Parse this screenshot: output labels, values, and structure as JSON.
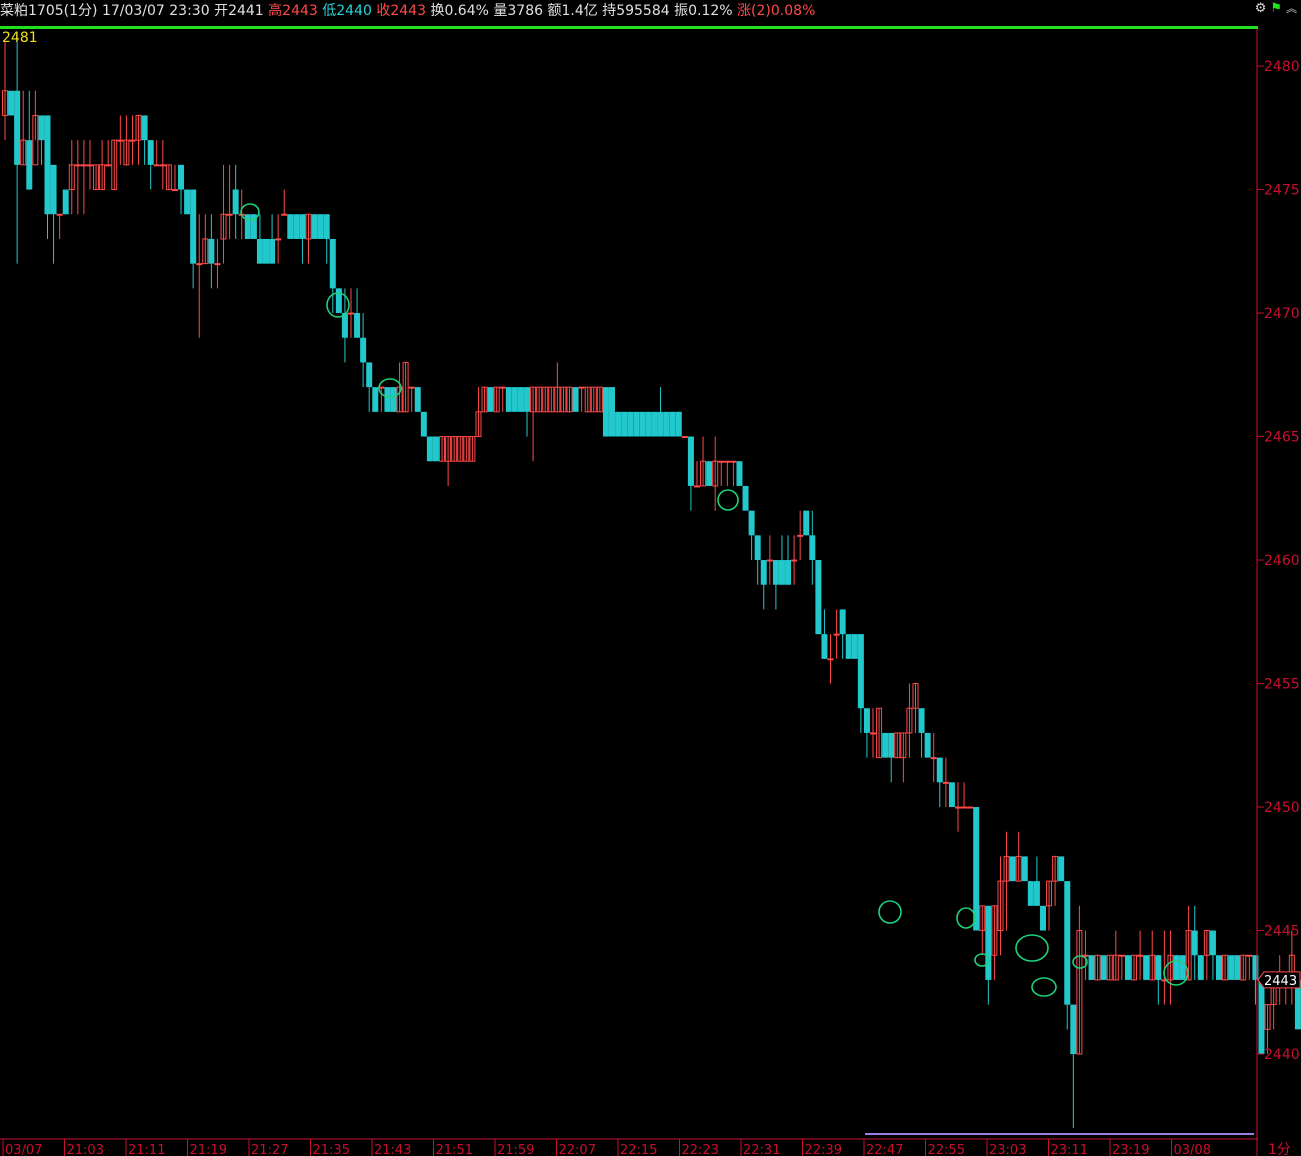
{
  "header": {
    "symbol": "菜粕1705",
    "period": "(1分)",
    "datetime": "17/03/07 23:30",
    "open_label": "开",
    "open": "2441",
    "high_label": "高",
    "high": "2443",
    "low_label": "低",
    "low": "2440",
    "close_label": "收",
    "close": "2443",
    "turnover_label": "换",
    "turnover": "0.64%",
    "volume_label": "量",
    "volume": "3786",
    "amount_label": "额",
    "amount": "1.4亿",
    "oi_label": "持",
    "oi": "595584",
    "amp_label": "振",
    "amp": "0.12%",
    "chg_label": "涨(2)",
    "chg": "0.08%",
    "icons": [
      "gear-icon",
      "flag-icon",
      "chevron-up-icon"
    ]
  },
  "top_price_label": "2481",
  "current_price_tag": "2443",
  "period_button": "1分",
  "colors": {
    "up": "#ff4a4a",
    "down": "#22c8cc",
    "accent": "#22e01e",
    "annot": "#1fd07a"
  },
  "chart_data": {
    "type": "candlestick",
    "symbol": "菜粕1705",
    "y_ticks": [
      2480,
      2475,
      2470,
      2465,
      2460,
      2455,
      2450,
      2445,
      2440
    ],
    "ylim": [
      2436.6,
      2481.5
    ],
    "x_ticks": [
      "03/07",
      "21:03",
      "21:11",
      "21:19",
      "21:27",
      "21:35",
      "21:43",
      "21:51",
      "21:59",
      "22:07",
      "22:15",
      "22:23",
      "22:31",
      "22:39",
      "22:47",
      "22:55",
      "23:03",
      "23:11",
      "23:19",
      "03/08"
    ],
    "candles": [
      [
        2478,
        2479,
        2477,
        2481
      ],
      [
        2479,
        2478,
        2478,
        2479
      ],
      [
        2479,
        2476,
        2472,
        2481
      ],
      [
        2476,
        2477,
        2476,
        2479
      ],
      [
        2477,
        2475,
        2475,
        2479
      ],
      [
        2476,
        2478,
        2477,
        2479
      ],
      [
        2478,
        2477,
        2476,
        2478
      ],
      [
        2478,
        2474,
        2473,
        2478
      ],
      [
        2476,
        2474,
        2472,
        2476
      ],
      [
        2474,
        2474,
        2473,
        2474
      ],
      [
        2475,
        2474,
        2474,
        2475
      ],
      [
        2475,
        2476,
        2474,
        2477
      ],
      [
        2476,
        2476,
        2474,
        2477
      ],
      [
        2476,
        2476,
        2474,
        2477
      ],
      [
        2476,
        2476,
        2475,
        2477
      ],
      [
        2475,
        2476,
        2475,
        2476
      ],
      [
        2475,
        2476,
        2475,
        2477
      ],
      [
        2476,
        2476,
        2476,
        2477
      ],
      [
        2475,
        2477,
        2475,
        2477
      ],
      [
        2477,
        2477,
        2476,
        2478
      ],
      [
        2476,
        2477,
        2476,
        2478
      ],
      [
        2477,
        2477,
        2476,
        2478
      ],
      [
        2477,
        2478,
        2476,
        2478
      ],
      [
        2478,
        2477,
        2476,
        2478
      ],
      [
        2477,
        2476,
        2475,
        2477
      ],
      [
        2476,
        2476,
        2476,
        2477
      ],
      [
        2476,
        2476,
        2475,
        2477
      ],
      [
        2475,
        2476,
        2475,
        2476
      ],
      [
        2475,
        2475,
        2475,
        2476
      ],
      [
        2476,
        2475,
        2474,
        2476
      ],
      [
        2475,
        2474,
        2474,
        2475
      ],
      [
        2475,
        2472,
        2471,
        2475
      ],
      [
        2472,
        2472,
        2469,
        2474
      ],
      [
        2472,
        2473,
        2472,
        2474
      ],
      [
        2473,
        2472,
        2471,
        2474
      ],
      [
        2472,
        2472,
        2471,
        2473
      ],
      [
        2473,
        2474,
        2472,
        2476
      ],
      [
        2474,
        2474,
        2473,
        2476
      ],
      [
        2475,
        2474,
        2473,
        2476
      ],
      [
        2474,
        2474,
        2473,
        2475
      ],
      [
        2474,
        2473,
        2473,
        2474
      ],
      [
        2474,
        2473,
        2473,
        2474
      ],
      [
        2473,
        2472,
        2472,
        2474
      ],
      [
        2473,
        2472,
        2472,
        2473
      ],
      [
        2473,
        2472,
        2472,
        2474
      ],
      [
        2473,
        2473,
        2472,
        2474
      ],
      [
        2474,
        2474,
        2474,
        2475
      ],
      [
        2474,
        2473,
        2473,
        2474
      ],
      [
        2474,
        2473,
        2473,
        2474
      ],
      [
        2474,
        2473,
        2472,
        2474
      ],
      [
        2473,
        2474,
        2472,
        2474
      ],
      [
        2474,
        2473,
        2473,
        2474
      ],
      [
        2474,
        2473,
        2473,
        2474
      ],
      [
        2474,
        2473,
        2472,
        2474
      ],
      [
        2473,
        2471,
        2470,
        2473
      ],
      [
        2471,
        2470,
        2470,
        2471
      ],
      [
        2470,
        2469,
        2468,
        2471
      ],
      [
        2470,
        2470,
        2469,
        2471
      ],
      [
        2470,
        2469,
        2469,
        2471
      ],
      [
        2469,
        2468,
        2467,
        2470
      ],
      [
        2468,
        2467,
        2466,
        2468
      ],
      [
        2467,
        2466,
        2466,
        2467
      ],
      [
        2467,
        2467,
        2466,
        2467
      ],
      [
        2467,
        2466,
        2466,
        2467
      ],
      [
        2467,
        2466,
        2466,
        2467
      ],
      [
        2466,
        2467,
        2466,
        2468
      ],
      [
        2466,
        2468,
        2466,
        2468
      ],
      [
        2467,
        2467,
        2466,
        2467
      ],
      [
        2467,
        2466,
        2466,
        2467
      ],
      [
        2466,
        2465,
        2465,
        2466
      ],
      [
        2465,
        2464,
        2464,
        2465
      ],
      [
        2465,
        2464,
        2464,
        2465
      ],
      [
        2464,
        2465,
        2464,
        2465
      ],
      [
        2464,
        2465,
        2463,
        2465
      ],
      [
        2464,
        2465,
        2464,
        2465
      ],
      [
        2464,
        2465,
        2464,
        2465
      ],
      [
        2464,
        2465,
        2464,
        2465
      ],
      [
        2464,
        2465,
        2464,
        2465
      ],
      [
        2465,
        2466,
        2465,
        2467
      ],
      [
        2466,
        2467,
        2466,
        2467
      ],
      [
        2467,
        2466,
        2466,
        2467
      ],
      [
        2466,
        2467,
        2466,
        2467
      ],
      [
        2467,
        2467,
        2466,
        2467
      ],
      [
        2467,
        2466,
        2466,
        2467
      ],
      [
        2467,
        2466,
        2466,
        2467
      ],
      [
        2467,
        2466,
        2466,
        2467
      ],
      [
        2467,
        2466,
        2465,
        2467
      ],
      [
        2466,
        2467,
        2464,
        2467
      ],
      [
        2466,
        2467,
        2466,
        2467
      ],
      [
        2466,
        2467,
        2466,
        2467
      ],
      [
        2466,
        2467,
        2466,
        2467
      ],
      [
        2466,
        2467,
        2466,
        2468
      ],
      [
        2466,
        2467,
        2466,
        2467
      ],
      [
        2466,
        2467,
        2466,
        2467
      ],
      [
        2467,
        2466,
        2466,
        2467
      ],
      [
        2467,
        2467,
        2466,
        2467
      ],
      [
        2466,
        2467,
        2466,
        2467
      ],
      [
        2466,
        2467,
        2466,
        2467
      ],
      [
        2466,
        2467,
        2466,
        2467
      ],
      [
        2467,
        2465,
        2465,
        2467
      ],
      [
        2467,
        2465,
        2465,
        2467
      ],
      [
        2466,
        2465,
        2465,
        2466
      ],
      [
        2466,
        2465,
        2465,
        2466
      ],
      [
        2466,
        2465,
        2465,
        2466
      ],
      [
        2466,
        2465,
        2465,
        2466
      ],
      [
        2466,
        2465,
        2465,
        2466
      ],
      [
        2466,
        2465,
        2465,
        2466
      ],
      [
        2466,
        2465,
        2465,
        2466
      ],
      [
        2466,
        2465,
        2465,
        2467
      ],
      [
        2466,
        2465,
        2465,
        2466
      ],
      [
        2466,
        2465,
        2465,
        2466
      ],
      [
        2466,
        2465,
        2465,
        2466
      ],
      [
        2465,
        2465,
        2465,
        2465
      ],
      [
        2465,
        2463,
        2462,
        2465
      ],
      [
        2463,
        2463,
        2463,
        2464
      ],
      [
        2463,
        2464,
        2463,
        2465
      ],
      [
        2464,
        2463,
        2463,
        2464
      ],
      [
        2463,
        2464,
        2462,
        2465
      ],
      [
        2464,
        2464,
        2463,
        2464
      ],
      [
        2464,
        2464,
        2463,
        2464
      ],
      [
        2464,
        2464,
        2463,
        2464
      ],
      [
        2464,
        2463,
        2463,
        2464
      ],
      [
        2463,
        2462,
        2462,
        2463
      ],
      [
        2462,
        2461,
        2460,
        2462
      ],
      [
        2461,
        2460,
        2459,
        2461
      ],
      [
        2460,
        2459,
        2458,
        2460
      ],
      [
        2460,
        2460,
        2459,
        2461
      ],
      [
        2460,
        2459,
        2458,
        2460
      ],
      [
        2460,
        2459,
        2459,
        2461
      ],
      [
        2460,
        2459,
        2459,
        2461
      ],
      [
        2460,
        2460,
        2459,
        2461
      ],
      [
        2461,
        2461,
        2460,
        2462
      ],
      [
        2462,
        2461,
        2461,
        2462
      ],
      [
        2461,
        2460,
        2459,
        2462
      ],
      [
        2460,
        2457,
        2457,
        2460
      ],
      [
        2457,
        2456,
        2456,
        2458
      ],
      [
        2456,
        2456,
        2455,
        2457
      ],
      [
        2457,
        2457,
        2456,
        2458
      ],
      [
        2458,
        2457,
        2456,
        2458
      ],
      [
        2457,
        2456,
        2456,
        2457
      ],
      [
        2457,
        2456,
        2456,
        2457
      ],
      [
        2457,
        2454,
        2453,
        2457
      ],
      [
        2454,
        2453,
        2452,
        2454
      ],
      [
        2453,
        2453,
        2452,
        2454
      ],
      [
        2452,
        2454,
        2452,
        2454
      ],
      [
        2453,
        2452,
        2452,
        2453
      ],
      [
        2453,
        2452,
        2451,
        2453
      ],
      [
        2452,
        2453,
        2452,
        2453
      ],
      [
        2452,
        2453,
        2451,
        2453
      ],
      [
        2453,
        2454,
        2452,
        2455
      ],
      [
        2454,
        2455,
        2453,
        2455
      ],
      [
        2454,
        2453,
        2452,
        2454
      ],
      [
        2453,
        2452,
        2452,
        2453
      ],
      [
        2452,
        2452,
        2451,
        2453
      ],
      [
        2452,
        2451,
        2450,
        2452
      ],
      [
        2451,
        2451,
        2450,
        2452
      ],
      [
        2451,
        2450,
        2450,
        2451
      ],
      [
        2450,
        2450,
        2449,
        2451
      ],
      [
        2450,
        2450,
        2450,
        2451
      ],
      [
        2450,
        2450,
        2450,
        2450
      ],
      [
        2450,
        2445,
        2445,
        2450
      ],
      [
        2445,
        2446,
        2444,
        2446
      ],
      [
        2446,
        2443,
        2442,
        2446
      ],
      [
        2444,
        2446,
        2443,
        2446
      ],
      [
        2445,
        2447,
        2444,
        2448
      ],
      [
        2447,
        2448,
        2445,
        2449
      ],
      [
        2448,
        2447,
        2447,
        2448
      ],
      [
        2447,
        2448,
        2447,
        2449
      ],
      [
        2448,
        2447,
        2447,
        2448
      ],
      [
        2447,
        2446,
        2446,
        2447
      ],
      [
        2447,
        2446,
        2446,
        2448
      ],
      [
        2446,
        2445,
        2445,
        2446
      ],
      [
        2446,
        2447,
        2445,
        2447
      ],
      [
        2447,
        2448,
        2446,
        2448
      ],
      [
        2448,
        2447,
        2447,
        2448
      ],
      [
        2447,
        2442,
        2441,
        2447
      ],
      [
        2442,
        2440,
        2437,
        2442
      ],
      [
        2440,
        2445,
        2440,
        2446
      ],
      [
        2444,
        2444,
        2443,
        2445
      ],
      [
        2444,
        2443,
        2443,
        2444
      ],
      [
        2443,
        2444,
        2443,
        2444
      ],
      [
        2444,
        2443,
        2443,
        2444
      ],
      [
        2443,
        2444,
        2443,
        2444
      ],
      [
        2443,
        2444,
        2443,
        2445
      ],
      [
        2444,
        2444,
        2443,
        2444
      ],
      [
        2444,
        2443,
        2443,
        2444
      ],
      [
        2443,
        2444,
        2443,
        2444
      ],
      [
        2444,
        2444,
        2443,
        2445
      ],
      [
        2444,
        2443,
        2443,
        2444
      ],
      [
        2443,
        2444,
        2443,
        2445
      ],
      [
        2444,
        2443,
        2442,
        2444
      ],
      [
        2443,
        2443,
        2442,
        2445
      ],
      [
        2443,
        2444,
        2442,
        2445
      ],
      [
        2444,
        2443,
        2443,
        2444
      ],
      [
        2444,
        2443,
        2443,
        2444
      ],
      [
        2443,
        2445,
        2443,
        2446
      ],
      [
        2445,
        2444,
        2443,
        2446
      ],
      [
        2444,
        2443,
        2443,
        2444
      ],
      [
        2444,
        2445,
        2443,
        2445
      ],
      [
        2445,
        2444,
        2443,
        2445
      ],
      [
        2444,
        2443,
        2443,
        2444
      ],
      [
        2443,
        2444,
        2443,
        2444
      ],
      [
        2444,
        2443,
        2443,
        2444
      ],
      [
        2444,
        2443,
        2443,
        2444
      ],
      [
        2443,
        2444,
        2443,
        2444
      ],
      [
        2444,
        2444,
        2443,
        2444
      ],
      [
        2444,
        2443,
        2442,
        2444
      ],
      [
        2443,
        2440,
        2440,
        2443
      ],
      [
        2441,
        2442,
        2440,
        2442
      ],
      [
        2442,
        2443,
        2441,
        2443
      ],
      [
        2443,
        2443,
        2442,
        2444
      ],
      [
        2443,
        2443,
        2442,
        2443
      ],
      [
        2443,
        2444,
        2442,
        2445
      ],
      [
        2443,
        2441,
        2441,
        2443
      ],
      [
        2442,
        2442,
        2441,
        2443
      ],
      [
        2441,
        2442,
        2440,
        2442
      ],
      [
        2441,
        2443,
        2440,
        2443
      ]
    ]
  }
}
